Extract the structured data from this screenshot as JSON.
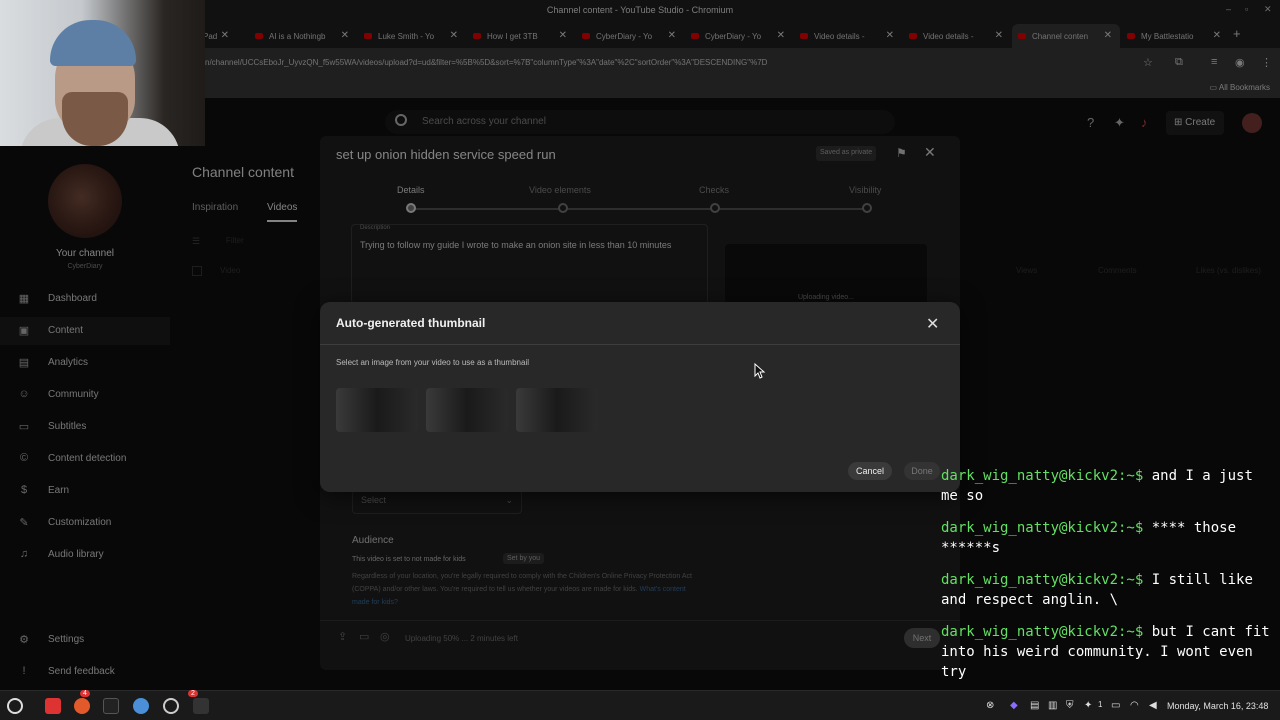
{
  "window": {
    "title": "Channel content - YouTube Studio - Chromium"
  },
  "tabs": [
    {
      "label": "Pad"
    },
    {
      "label": "AI is a Nothingb"
    },
    {
      "label": "Luke Smith - Yo"
    },
    {
      "label": "How I get 3TB"
    },
    {
      "label": "CyberDiary - Yo"
    },
    {
      "label": "CyberDiary - Yo"
    },
    {
      "label": "Video details -"
    },
    {
      "label": "Video details -"
    },
    {
      "label": "Channel conten"
    },
    {
      "label": "My Battlestatio"
    }
  ],
  "address": {
    "url": "n/channel/UCCsEboJr_UyvzQN_f5w55WA/videos/upload?d=ud&filter=%5B%5D&sort=%7B\"columnType\"%3A\"date\"%2C\"sortOrder\"%3A\"DESCENDING\"%7D"
  },
  "bookmarks": {
    "all": "All Bookmarks"
  },
  "header": {
    "search_placeholder": "Search across your channel",
    "create": "Create"
  },
  "sidebar": {
    "your_channel": "Your channel",
    "channel_name": "CyberDiary",
    "items": [
      {
        "label": "Dashboard",
        "icon": "dashboard-icon"
      },
      {
        "label": "Content",
        "icon": "content-icon",
        "active": true
      },
      {
        "label": "Analytics",
        "icon": "analytics-icon"
      },
      {
        "label": "Community",
        "icon": "community-icon"
      },
      {
        "label": "Subtitles",
        "icon": "subtitles-icon"
      },
      {
        "label": "Content detection",
        "icon": "copyright-icon"
      },
      {
        "label": "Earn",
        "icon": "earn-icon"
      },
      {
        "label": "Customization",
        "icon": "customization-icon"
      },
      {
        "label": "Audio library",
        "icon": "audio-library-icon"
      }
    ],
    "bottom": [
      {
        "label": "Settings"
      },
      {
        "label": "Send feedback"
      }
    ]
  },
  "channel_content": {
    "title": "Channel content",
    "tabs": [
      "Inspiration",
      "Videos"
    ],
    "filter": "Filter",
    "col_video": "Video",
    "col_views": "Views",
    "col_comments": "Comments",
    "col_likes": "Likes (vs. dislikes)"
  },
  "details_dialog": {
    "title": "set up onion hidden service speed run",
    "saved": "Saved as private",
    "steps": [
      "Details",
      "Video elements",
      "Checks",
      "Visibility"
    ],
    "description_label": "Description",
    "description": "Trying to follow my guide I wrote to make an onion site in less than 10 minutes",
    "uploading_video": "Uploading video...",
    "select": "Select",
    "audience_title": "Audience",
    "audience_status": "This video is set to not made for kids",
    "set_by_you": "Set by you",
    "audience_text": "Regardless of your location, you're legally required to comply with the Children's Online Privacy Protection Act (COPPA) and/or other laws. You're required to tell us whether your videos are made for kids.",
    "audience_link": "What's content made for kids?",
    "upload_status": "Uploading 50% ... 2 minutes left",
    "next": "Next"
  },
  "modal": {
    "title": "Auto-generated thumbnail",
    "instruction": "Select an image from your video to use as a thumbnail",
    "cancel": "Cancel",
    "done": "Done"
  },
  "terminal": {
    "lines": [
      {
        "prompt": "dark_wig_natty@kickv2:~$",
        "text": " and I a just me so"
      },
      {
        "prompt": "dark_wig_natty@kickv2:~$",
        "text": " **** those ******s"
      },
      {
        "prompt": "dark_wig_natty@kickv2:~$",
        "text": " I still like and respect anglin. \\"
      },
      {
        "prompt": "dark_wig_natty@kickv2:~$",
        "text": " but I cant fit into his weird community. I wont even try"
      }
    ]
  },
  "taskbar": {
    "badge1": "4",
    "badge2": "2",
    "clock": "Monday, March 16, 23:48",
    "tray_count": "1"
  },
  "colors": {
    "accent": "#3ea6ff",
    "prompt": "#63e063",
    "youtube_red": "#ff0000"
  }
}
